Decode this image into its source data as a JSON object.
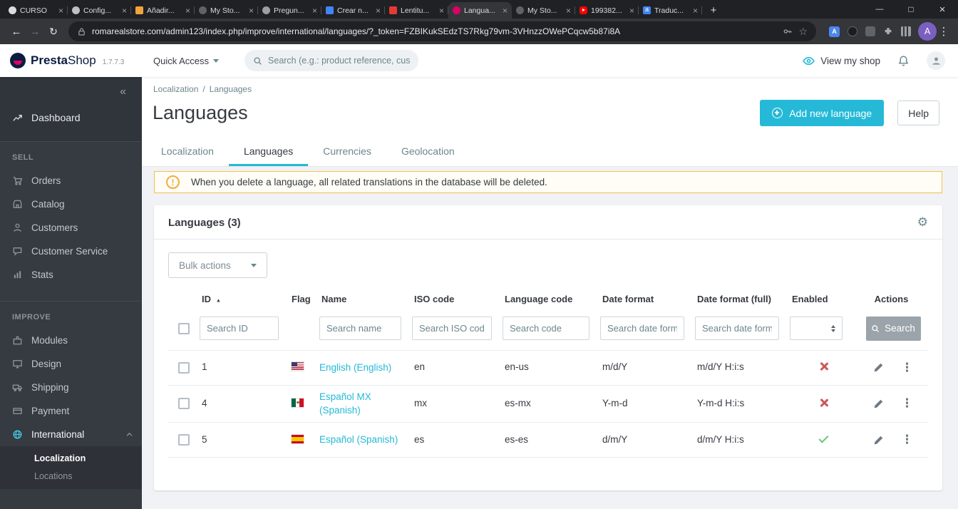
{
  "browser": {
    "tabs": [
      {
        "label": "CURSO",
        "fav": "fav-light"
      },
      {
        "label": "Config...",
        "fav": "fav-key"
      },
      {
        "label": "Añadir...",
        "fav": "fav-orange"
      },
      {
        "label": "My Sto...",
        "fav": "fav-dark"
      },
      {
        "label": "Pregun...",
        "fav": "fav-gray"
      },
      {
        "label": "Crear n...",
        "fav": "fav-blue"
      },
      {
        "label": "Lentitu...",
        "fav": "fav-red"
      },
      {
        "label": "Langua...",
        "fav": "fav-prestashop"
      },
      {
        "label": "My Sto...",
        "fav": "fav-dark"
      },
      {
        "label": "199382...",
        "fav": "fav-youtube"
      },
      {
        "label": "Traduc...",
        "fav": "fav-translate"
      }
    ],
    "url": "romarealstore.com/admin123/index.php/improve/international/languages/?_token=FZBIKukSEdzTS7Rkg79vm-3VHnzzOWePCqcw5b87i8A",
    "profile_initial": "A"
  },
  "ps_header": {
    "logo_presta": "Presta",
    "logo_shop": "Shop",
    "version": "1.7.7.3",
    "quick_access": "Quick Access",
    "search_placeholder": "Search (e.g.: product reference, custome",
    "view_my_shop": "View my shop"
  },
  "sidebar": {
    "dashboard": "Dashboard",
    "sell_title": "SELL",
    "sell_items": [
      "Orders",
      "Catalog",
      "Customers",
      "Customer Service",
      "Stats"
    ],
    "improve_title": "IMPROVE",
    "improve_items": [
      "Modules",
      "Design",
      "Shipping",
      "Payment",
      "International"
    ],
    "submenu": [
      "Localization",
      "Locations"
    ]
  },
  "page": {
    "breadcrumb": {
      "parent": "Localization",
      "current": "Languages"
    },
    "title": "Languages",
    "add_button": "Add new language",
    "help_button": "Help",
    "tabs": [
      "Localization",
      "Languages",
      "Currencies",
      "Geolocation"
    ],
    "alert": "When you delete a language, all related translations in the database will be deleted.",
    "panel": {
      "title": "Languages (3)",
      "bulk_actions": "Bulk actions",
      "headers": {
        "id": "ID",
        "flag": "Flag",
        "name": "Name",
        "iso": "ISO code",
        "code": "Language code",
        "date": "Date format",
        "date_full": "Date format (full)",
        "enabled": "Enabled",
        "actions": "Actions"
      },
      "filters": {
        "id": "Search ID",
        "name": "Search name",
        "iso": "Search ISO code",
        "code": "Search code",
        "date": "Search date format",
        "date_full": "Search date format"
      },
      "search_button": "Search",
      "rows": [
        {
          "id": "1",
          "flag": "flag-us",
          "name": "English (English)",
          "iso": "en",
          "code": "en-us",
          "date": "m/d/Y",
          "date_full": "m/d/Y H:i:s",
          "enabled_icon": "cross-icon"
        },
        {
          "id": "4",
          "flag": "flag-mx",
          "name": "Español MX (Spanish)",
          "iso": "mx",
          "code": "es-mx",
          "date": "Y-m-d",
          "date_full": "Y-m-d H:i:s",
          "enabled_icon": "cross-icon"
        },
        {
          "id": "5",
          "flag": "flag-es",
          "name": "Español (Spanish)",
          "iso": "es",
          "code": "es-es",
          "date": "d/m/Y",
          "date_full": "d/m/Y H:i:s",
          "enabled_icon": "check-icon"
        }
      ]
    }
  }
}
